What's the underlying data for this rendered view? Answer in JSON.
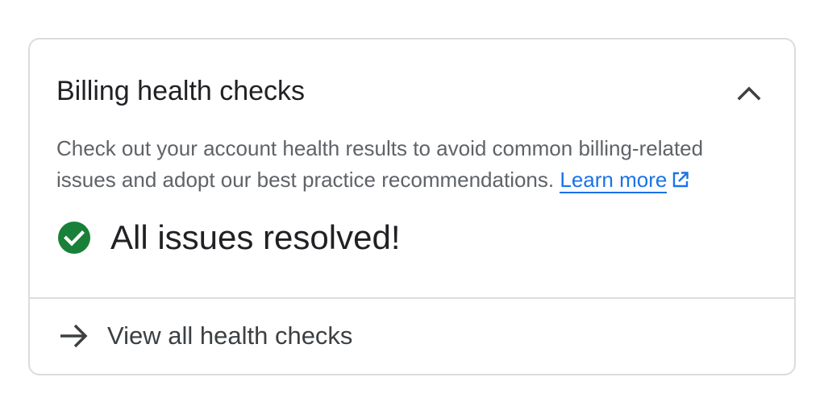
{
  "card": {
    "title": "Billing health checks",
    "description": "Check out your account health results to avoid common billing-related issues and adopt our best practice recommendations.",
    "learn_more_label": "Learn more",
    "status_text": "All issues resolved!",
    "footer_label": "View all health checks"
  },
  "icons": {
    "collapse": "chevron-up-icon",
    "external_link": "external-link-icon",
    "status": "check-circle-icon",
    "footer": "arrow-right-icon"
  },
  "colors": {
    "link": "#1a73e8",
    "success": "#188038",
    "title_text": "#202124",
    "body_text": "#5f6368",
    "border": "#dadce0"
  }
}
